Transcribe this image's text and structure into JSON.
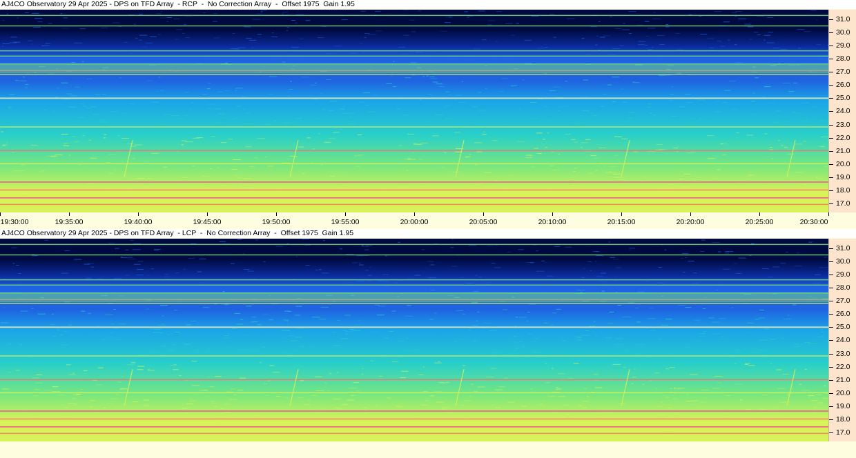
{
  "panels": [
    {
      "title": "AJ4CO Observatory 29 Apr 2025 - DPS on TFD Array  - RCP  -  No Correction Array  -  Offset 1975  Gain 1.95",
      "polarization": "RCP"
    },
    {
      "title": "AJ4CO Observatory 29 Apr 2025 - DPS on TFD Array  - LCP  -  No Correction Array  -  Offset 1975  Gain 1.95",
      "polarization": "LCP"
    }
  ],
  "chart_data": {
    "type": "heatmap",
    "x_tick_labels": [
      "19:30:00",
      "19:35:00",
      "19:40:00",
      "19:45:00",
      "19:50:00",
      "19:55:00",
      "20:00:00",
      "20:05:00",
      "20:10:00",
      "20:15:00",
      "20:20:00",
      "20:25:00",
      "20:30:00"
    ],
    "y_tick_labels": [
      "31.0",
      "30.0",
      "29.0",
      "28.0",
      "27.0",
      "26.0",
      "25.0",
      "24.0",
      "23.0",
      "22.0",
      "21.0",
      "20.0",
      "19.0",
      "18.0",
      "17.0"
    ],
    "y_values": [
      31,
      30,
      29,
      28,
      27,
      26,
      25,
      24,
      23,
      22,
      21,
      20,
      19,
      18,
      17
    ],
    "ylim": [
      16.3,
      31.75
    ],
    "xlim_minutes": [
      0,
      60
    ],
    "colormap": [
      "#000a40",
      "#0a2a9a",
      "#1f63e0",
      "#1aa4e8",
      "#2ad0c8",
      "#7ee87a",
      "#d8f25a",
      "#ff6a6a",
      "#ff2aa8"
    ],
    "rfi_lines_mhz": [
      31.3,
      30.5,
      28.6,
      28.2,
      27.6,
      27.1,
      26.8,
      25.0,
      22.8,
      21.0,
      20.0,
      18.6,
      18.0,
      17.4,
      16.9
    ],
    "bursts_minutes": [
      9.0,
      21.0,
      33.0,
      45.0,
      57.0
    ]
  }
}
